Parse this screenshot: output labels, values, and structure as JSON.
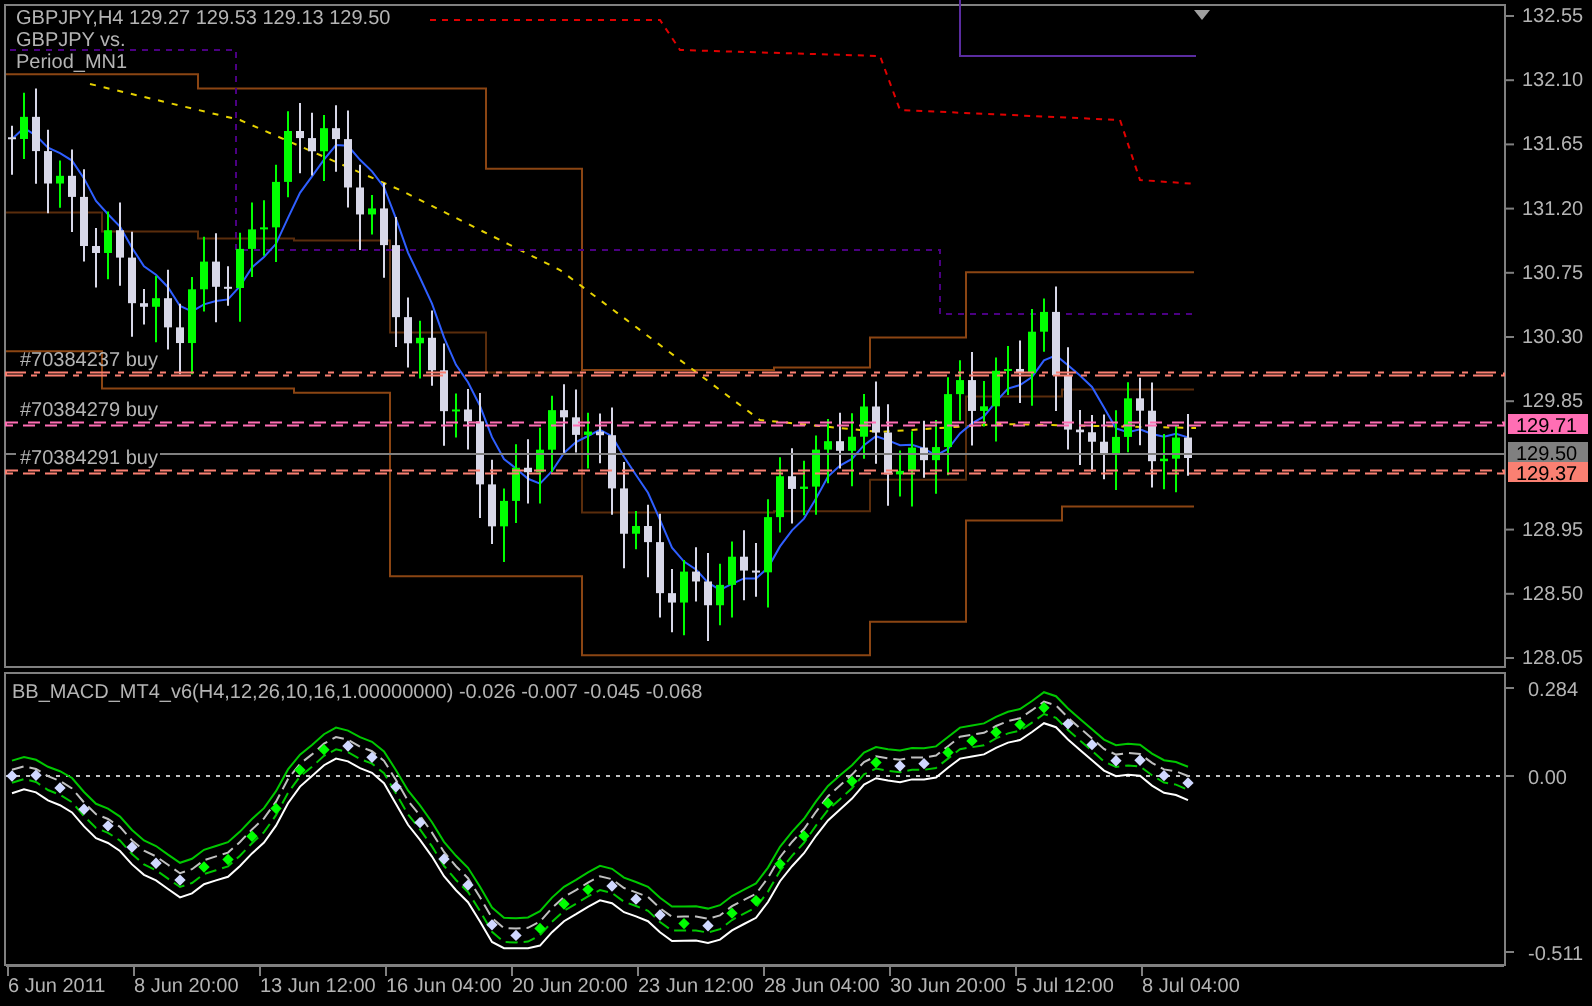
{
  "chart": {
    "header": [
      "GBPJPY,H4  129.27 129.53 129.13 129.50",
      "GBPJPY vs.",
      "Period_MN1"
    ],
    "orders": [
      {
        "label": "#70384237 buy",
        "color": "#fa8072"
      },
      {
        "label": "#70384279 buy",
        "color": "#ff6eb4"
      },
      {
        "label": "#70384291 buy",
        "color": "#fa8072"
      }
    ],
    "price_axis": [
      "132.55",
      "132.10",
      "131.65",
      "131.20",
      "130.75",
      "130.30",
      "129.85",
      "128.95",
      "128.50",
      "128.05"
    ],
    "price_badges": [
      {
        "text": "129.71",
        "color": "#ff6eb4"
      },
      {
        "text": "129.50",
        "color": "#808080"
      },
      {
        "text": "129.37",
        "color": "#fa8072"
      }
    ]
  },
  "indicator": {
    "title": "BB_MACD_MT4_v6(H4,12,26,10,16,1.00000000) -0.026 -0.007 -0.045 -0.068",
    "axis": [
      "0.284",
      "0.00",
      "-0.511"
    ]
  },
  "time_axis": [
    "6 Jun 2011",
    "8 Jun 20:00",
    "13 Jun 12:00",
    "16 Jun 04:00",
    "20 Jun 20:00",
    "23 Jun 12:00",
    "28 Jun 04:00",
    "30 Jun 20:00",
    "5 Jul 12:00",
    "8 Jul 04:00"
  ]
}
